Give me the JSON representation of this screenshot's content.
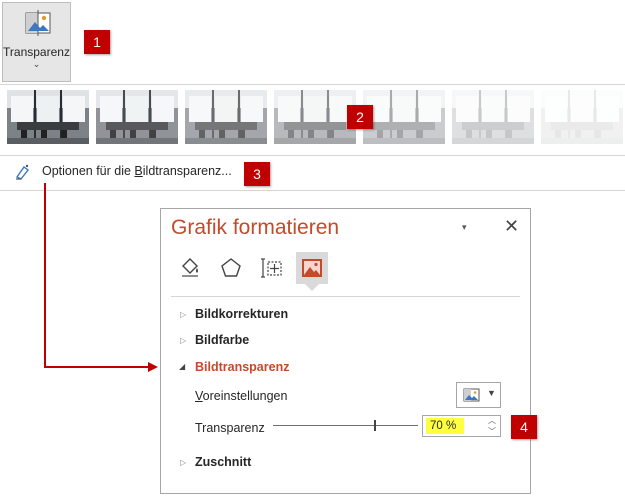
{
  "ribbon": {
    "transparency_label": "Transparenz",
    "chevron": "⌄"
  },
  "badges": [
    "1",
    "2",
    "3",
    "4"
  ],
  "gallery": {
    "presets_visible": 7,
    "opacity_levels": [
      1.0,
      0.85,
      0.7,
      0.55,
      0.4,
      0.25,
      0.1
    ]
  },
  "options_link": {
    "prefix": "Optionen für die ",
    "accel": "B",
    "suffix": "ildtransparenz..."
  },
  "pane": {
    "title": "Grafik formatieren",
    "dropdown_icon": "▾",
    "close_icon": "✕",
    "tabs": [
      "fill-line-icon",
      "effects-icon",
      "size-properties-icon",
      "picture-icon"
    ],
    "active_tab": "picture-icon",
    "sections": {
      "corrections": "Bildkorrekturen",
      "color": "Bildfarbe",
      "transparency": "Bildtransparenz",
      "crop": "Zuschnitt"
    },
    "presets_label_accel": "V",
    "presets_label_rest": "oreinstellungen",
    "transparency_label": "Transparenz",
    "transparency_value": "70 %",
    "slider_fraction": 0.7
  },
  "colors": {
    "badge": "#c00000",
    "title": "#c44a2b",
    "highlight": "#ffff40",
    "arrow": "#c00000"
  }
}
